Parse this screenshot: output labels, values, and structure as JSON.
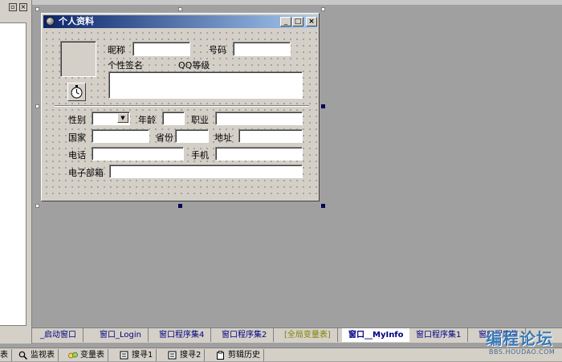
{
  "window": {
    "title": "个人资料",
    "minimize_glyph": "_",
    "maximize_glyph": "□",
    "close_glyph": "×"
  },
  "form": {
    "nickname_label": "昵称",
    "number_label": "号码",
    "signature_label": "个性签名",
    "qq_level_label": "QQ等级",
    "gender_label": "性别",
    "age_label": "年龄",
    "occupation_label": "职业",
    "country_label": "国家",
    "province_label": "省份",
    "address_label": "地址",
    "phone_label": "电话",
    "mobile_label": "手机",
    "email_label": "电子部箱",
    "gender_value": "",
    "nickname_value": "",
    "number_value": "",
    "signature_value": "",
    "age_value": "",
    "occupation_value": "",
    "country_value": "",
    "province_value": "",
    "address_value": "",
    "phone_value": "",
    "mobile_value": "",
    "email_value": ""
  },
  "tabs": [
    {
      "label": "_启动窗口"
    },
    {
      "label": "窗口_Login"
    },
    {
      "label": "窗口程序集4"
    },
    {
      "label": "窗口程序集2"
    },
    {
      "label": "[全局变量表]"
    },
    {
      "label": "窗口__MyInfo"
    },
    {
      "label": "窗口程序集1"
    },
    {
      "label": "窗口程序集"
    }
  ],
  "bottom_tabs": [
    {
      "label": "表",
      "icon": ""
    },
    {
      "label": "监视表",
      "icon": "magnifier-icon"
    },
    {
      "label": "变量表",
      "icon": "variables-icon"
    },
    {
      "label": "搜寻1",
      "icon": "search-result-icon"
    },
    {
      "label": "搜寻2",
      "icon": "search-result-icon"
    },
    {
      "label": "剪辑历史",
      "icon": "clipboard-icon"
    }
  ],
  "watermark": {
    "main": "编程论坛",
    "sub": "BBS.HOUDAO.COM"
  },
  "colors": {
    "titlebar_start": "#0a246a",
    "titlebar_end": "#a6caf0",
    "canvas": "#a0a0a0",
    "face": "#d4d0c8",
    "selected_handle": "#000080"
  }
}
